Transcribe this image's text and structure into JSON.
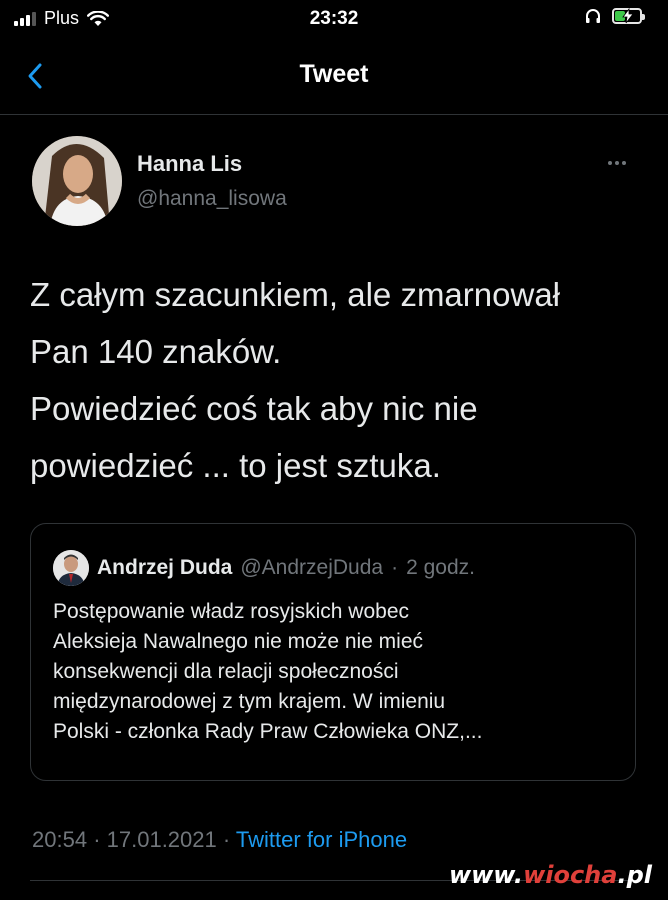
{
  "status_bar": {
    "carrier": "Plus",
    "time": "23:32",
    "battery_level": 0.4,
    "colors": {
      "battery_fill": "#3ec94a"
    }
  },
  "nav": {
    "title": "Tweet",
    "back_icon": "chevron-left-icon",
    "accent": "#1d9bf0"
  },
  "tweet": {
    "author_name": "Hanna Lis",
    "author_handle": "@hanna_lisowa",
    "text_lines": [
      "Z całym szacunkiem, ale zmarnował",
      "Pan 140 znaków.",
      "Powiedzieć coś tak aby nic nie",
      "powiedzieć ... to jest sztuka."
    ],
    "timestamp_time": "20:54",
    "timestamp_date": "17.01.2021",
    "source": "Twitter for iPhone",
    "separator": "·"
  },
  "quoted_tweet": {
    "author_name": "Andrzej Duda",
    "author_handle": "@AndrzejDuda",
    "age": "2 godz.",
    "separator": "·",
    "text_lines": [
      "Postępowanie władz rosyjskich wobec",
      "Aleksieja Nawalnego nie może nie mieć",
      "konsekwencji dla relacji społeczności",
      "międzynarodowej z tym krajem. W imieniu",
      "Polski - członka Rady Praw Człowieka ONZ,..."
    ]
  },
  "watermark": {
    "www": "www.",
    "name": "wiocha",
    "tld": ".pl"
  }
}
